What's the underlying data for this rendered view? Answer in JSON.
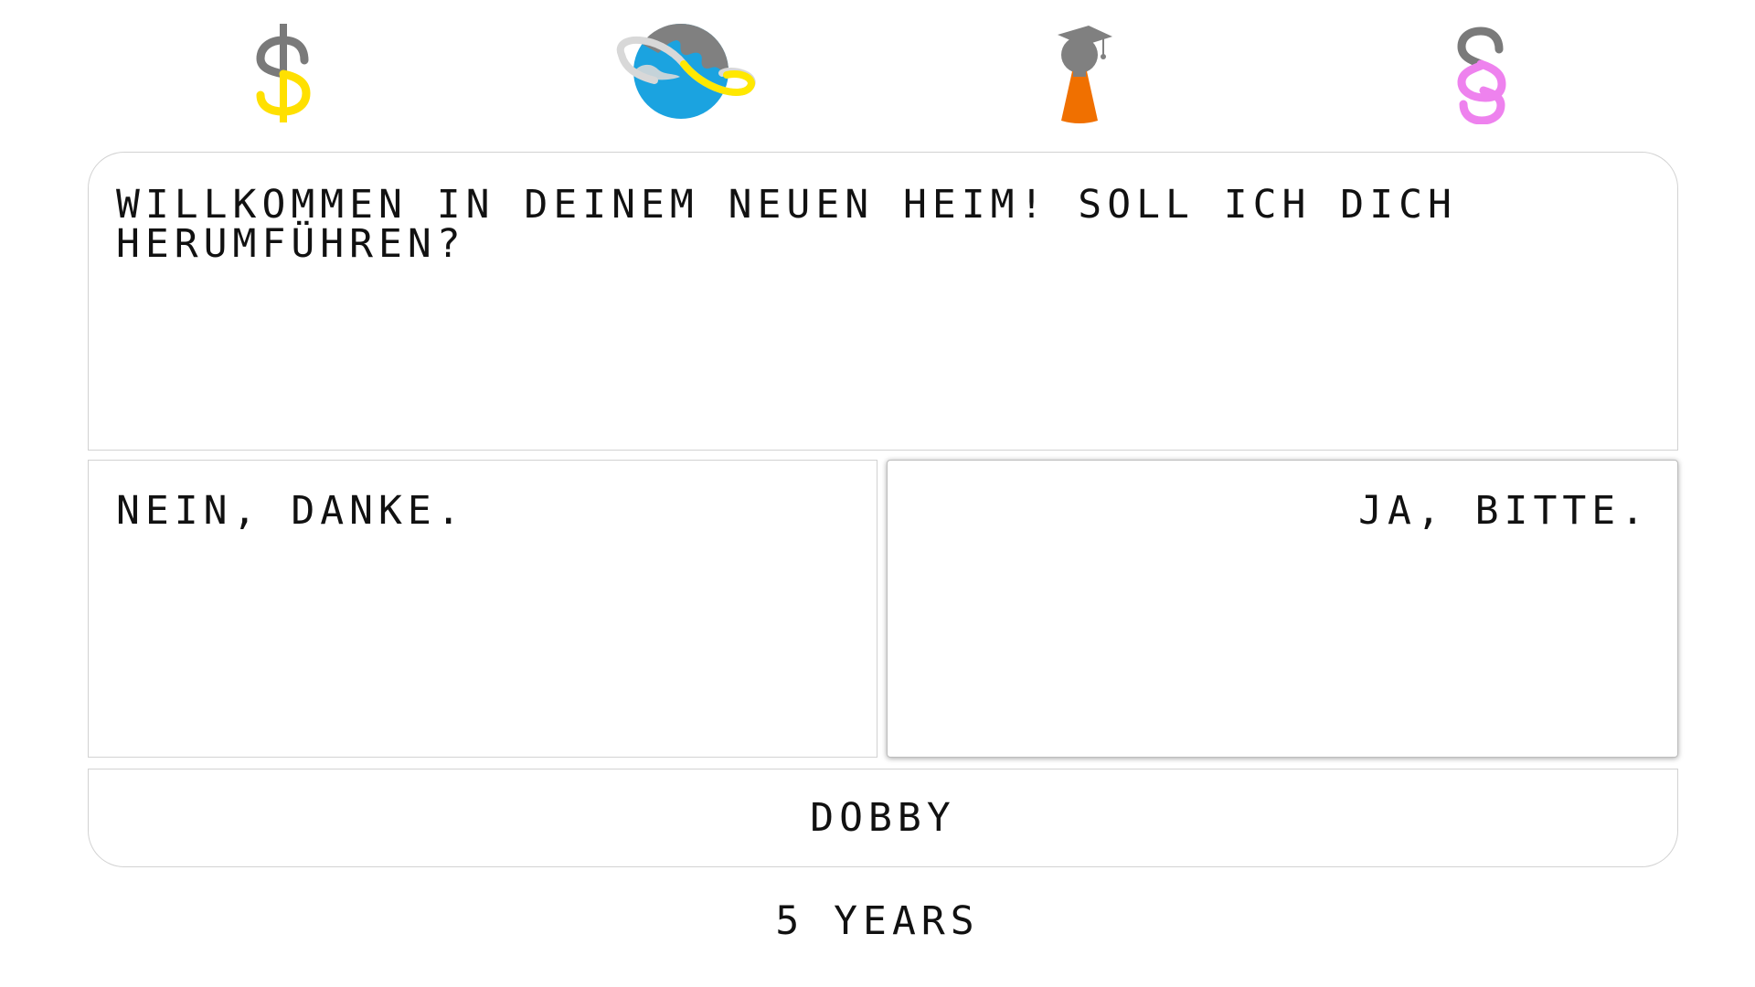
{
  "icons": [
    {
      "name": "dollar-icon",
      "color": "#ffe000"
    },
    {
      "name": "globe-icon",
      "colors": [
        "#1ba3e0",
        "#808080",
        "#ffe800",
        "#d8d8d8"
      ]
    },
    {
      "name": "graduate-icon",
      "colors": [
        "#808080",
        "#f07000"
      ]
    },
    {
      "name": "paragraph-icon",
      "color": "#ee82ee"
    }
  ],
  "question": {
    "text": "Willkommen in deinem neuen Heim! Soll ich dich herumführen?"
  },
  "choices": {
    "left": "Nein, danke.",
    "right": "Ja, bitte."
  },
  "character": {
    "name": "Dobby"
  },
  "age": {
    "label": "5 Years"
  }
}
